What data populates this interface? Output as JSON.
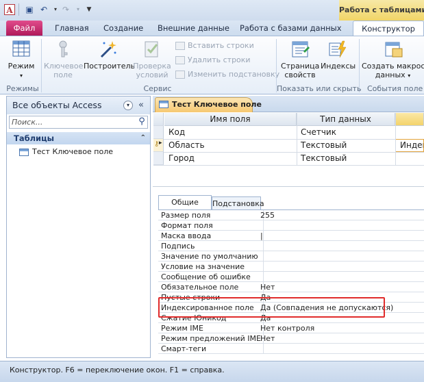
{
  "titlebar": {
    "contextual_tab_title": "Работа с таблицами"
  },
  "ribbon_tabs": {
    "file": "Файл",
    "home": "Главная",
    "create": "Создание",
    "external": "Внешние данные",
    "database_tools": "Работа с базами данных",
    "designer": "Конструктор"
  },
  "ribbon": {
    "view_label": "Режим",
    "primary_key_label_1": "Ключевое",
    "primary_key_label_2": "поле",
    "builder_label": "Построитель",
    "test_validation_label_1": "Проверка",
    "test_validation_label_2": "условий",
    "insert_rows": "Вставить строки",
    "delete_rows": "Удалить строки",
    "modify_lookups": "Изменить подстановку",
    "property_sheet_1": "Страница",
    "property_sheet_2": "свойств",
    "indexes": "Индексы",
    "create_macros_1": "Создать макросы",
    "create_macros_2": "данных",
    "group_views": "Режимы",
    "group_tools": "Сервис",
    "group_show_hide": "Показать или скрыть",
    "group_events": "События поле"
  },
  "nav": {
    "title": "Все объекты Access",
    "search_placeholder": "Поиск...",
    "group_label": "Таблицы",
    "items": [
      {
        "label": "Тест Ключевое поле"
      }
    ]
  },
  "document": {
    "tab_label": "Тест Ключевое поле",
    "headers": {
      "field_name": "Имя поля",
      "data_type": "Тип данных"
    },
    "rows": [
      {
        "name": "Код",
        "type": "Счетчик",
        "desc": ""
      },
      {
        "name": "Область",
        "type": "Текстовый",
        "desc": "Инден"
      },
      {
        "name": "Город",
        "type": "Текстовый",
        "desc": ""
      }
    ]
  },
  "properties": {
    "tabs": {
      "general": "Общие",
      "lookup": "Подстановка"
    },
    "rows": [
      {
        "label": "Размер поля",
        "value": "255"
      },
      {
        "label": "Формат поля",
        "value": ""
      },
      {
        "label": "Маска ввода",
        "value": "|"
      },
      {
        "label": "Подпись",
        "value": ""
      },
      {
        "label": "Значение по умолчанию",
        "value": ""
      },
      {
        "label": "Условие на значение",
        "value": ""
      },
      {
        "label": "Сообщение об ошибке",
        "value": ""
      },
      {
        "label": "Обязательное поле",
        "value": "Нет"
      },
      {
        "label": "Пустые строки",
        "value": "Да"
      },
      {
        "label": "Индексированное поле",
        "value": "Да (Совпадения не допускаются)"
      },
      {
        "label": "Сжатие Юникод",
        "value": "Да"
      },
      {
        "label": "Режим IME",
        "value": "Нет контроля"
      },
      {
        "label": "Режим предложений IME",
        "value": "Нет"
      },
      {
        "label": "Смарт-теги",
        "value": ""
      }
    ]
  },
  "status": {
    "text": "Конструктор.  F6 = переключение окон.  F1 = справка."
  },
  "colors": {
    "file_tab": "#b0195a",
    "contextual_tab": "#f1d567",
    "highlight_box": "#e02b2b",
    "doc_tab": "#f6c871"
  }
}
